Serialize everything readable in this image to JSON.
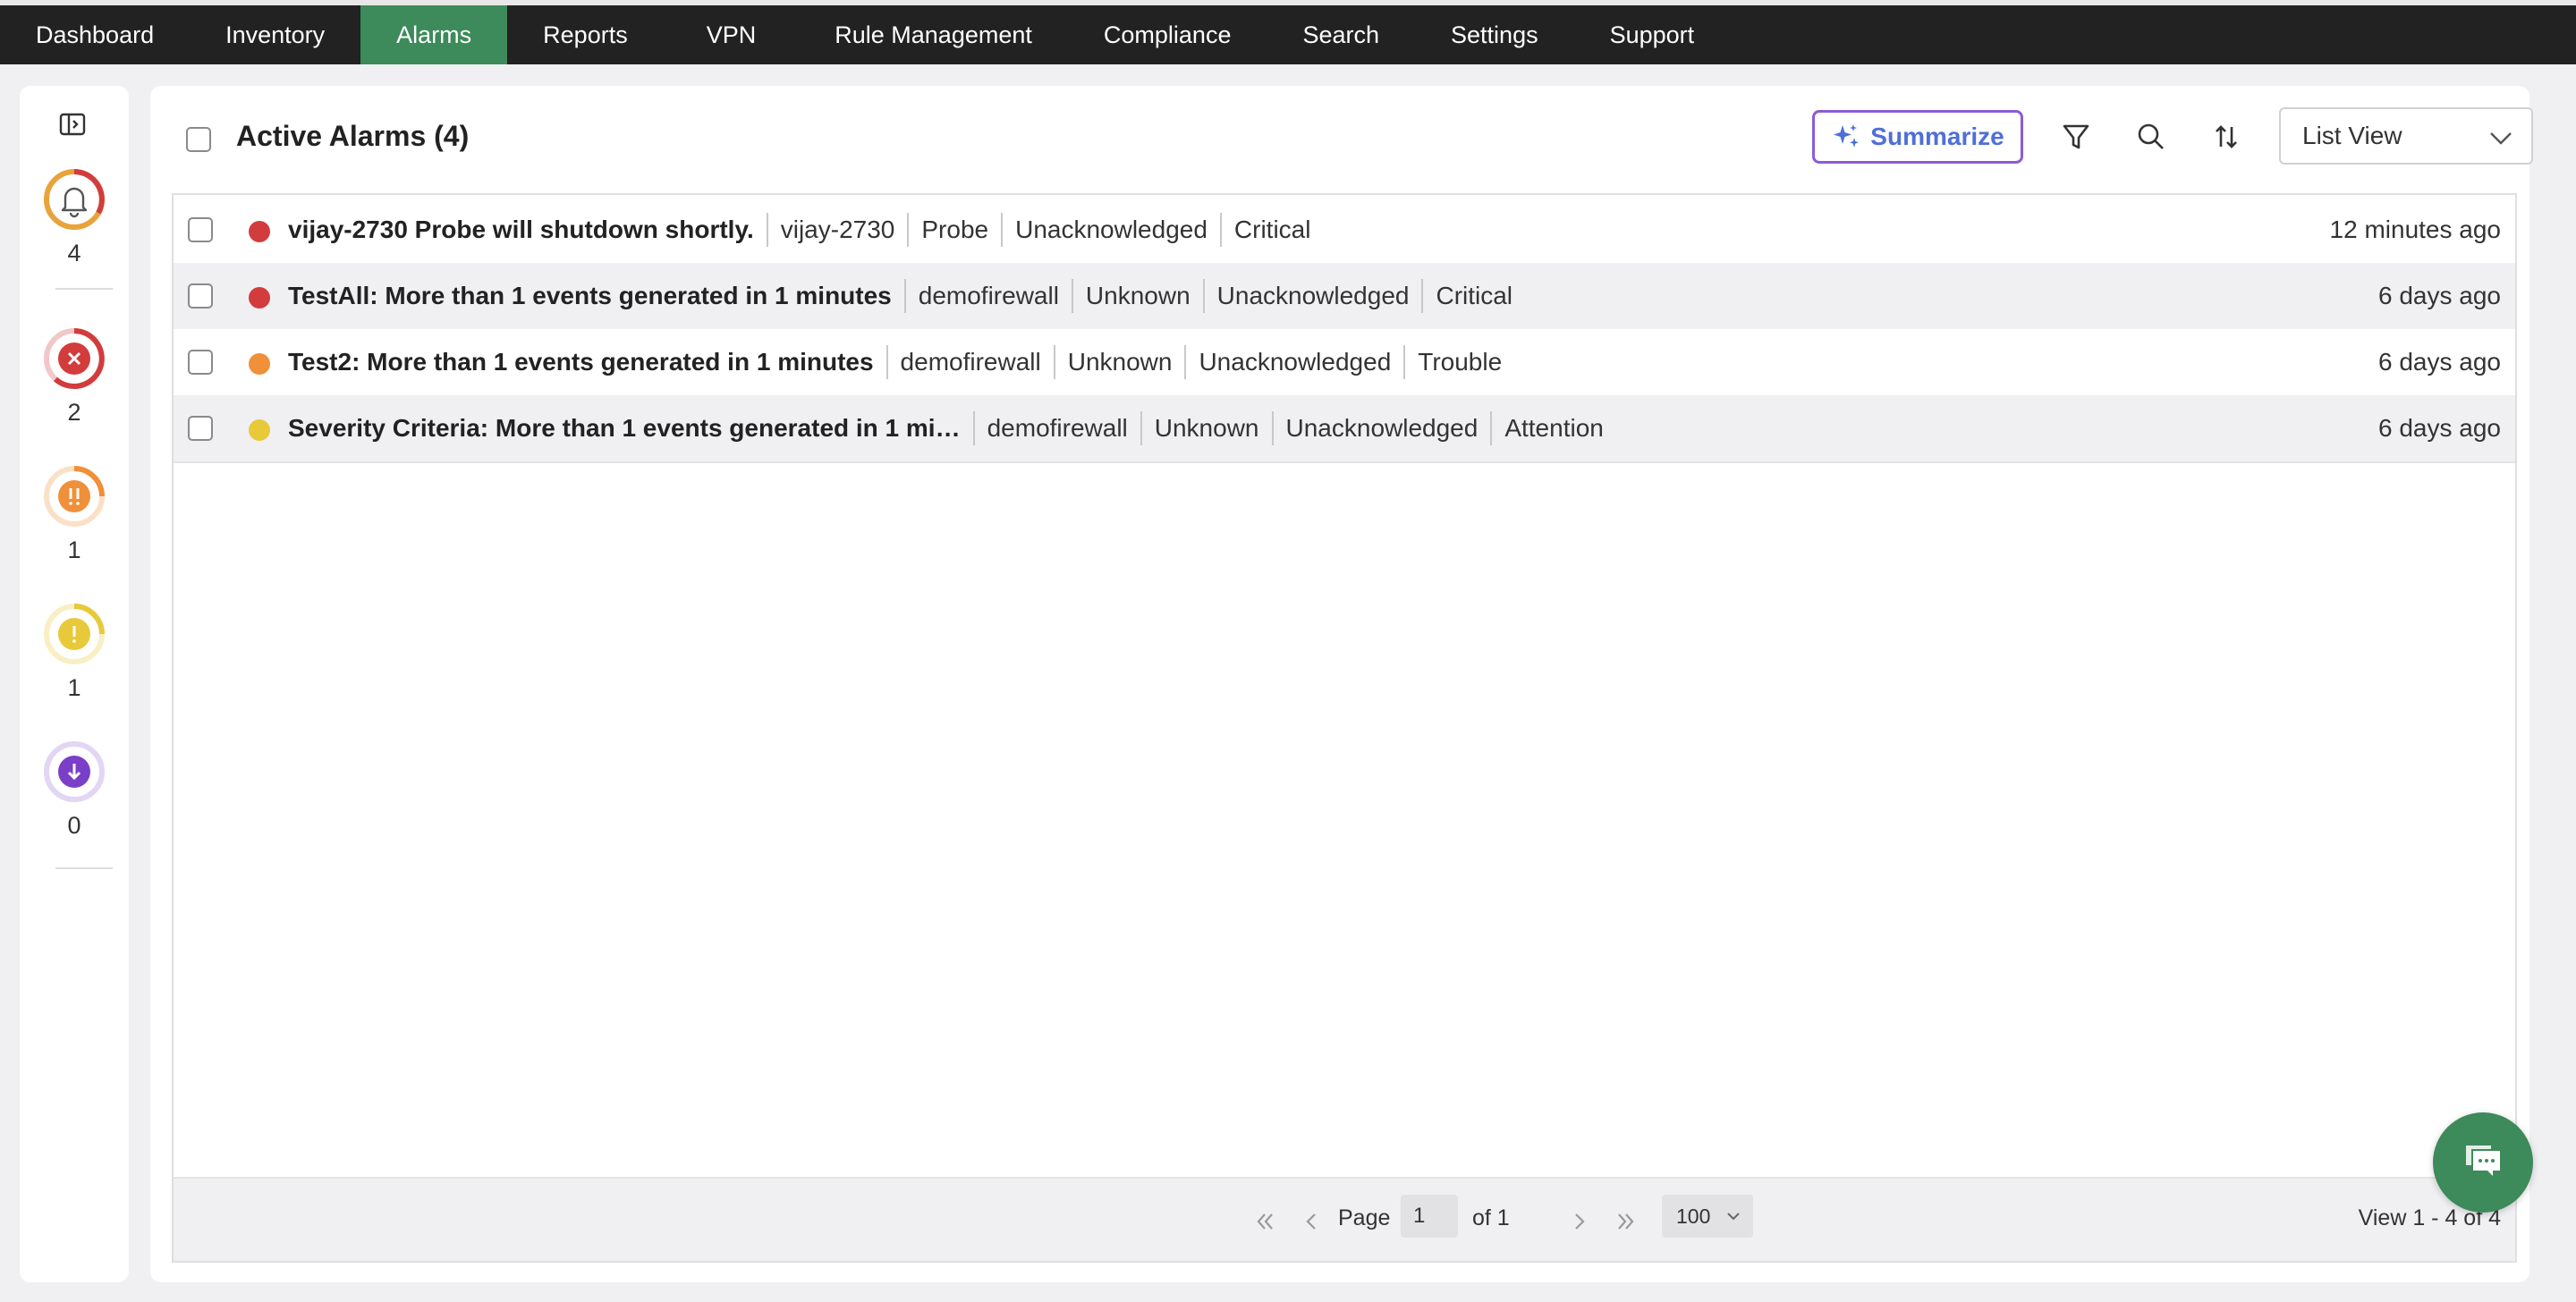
{
  "nav": {
    "items": [
      {
        "label": "Dashboard"
      },
      {
        "label": "Inventory"
      },
      {
        "label": "Alarms",
        "active": true
      },
      {
        "label": "Reports"
      },
      {
        "label": "VPN"
      },
      {
        "label": "Rule Management"
      },
      {
        "label": "Compliance"
      },
      {
        "label": "Search"
      },
      {
        "label": "Settings"
      },
      {
        "label": "Support"
      }
    ],
    "active_color": "#3d8a5a"
  },
  "sidebar": {
    "severities": [
      {
        "name": "all",
        "icon": "bell-icon",
        "count": "4",
        "color": "#e8a33a"
      },
      {
        "name": "critical",
        "icon": "x-circle-icon",
        "count": "2",
        "color": "#d23c3c"
      },
      {
        "name": "trouble",
        "icon": "double-exclamation-icon",
        "count": "1",
        "color": "#f0903a"
      },
      {
        "name": "attention",
        "icon": "exclamation-icon",
        "count": "1",
        "color": "#e8c93a"
      },
      {
        "name": "service-down",
        "icon": "arrow-down-icon",
        "count": "0",
        "color": "#7a3fc8"
      }
    ]
  },
  "main": {
    "title": "Active Alarms (4)",
    "summarize_label": "Summarize",
    "view_select": "List View"
  },
  "alarms": [
    {
      "title": "vijay-2730 Probe will shutdown shortly.",
      "cells": [
        "vijay-2730",
        "Probe",
        "Unacknowledged",
        "Critical"
      ],
      "time": "12 minutes ago",
      "severity_color": "#d23c3c"
    },
    {
      "title": "TestAll: More than 1 events generated in 1 minutes",
      "cells": [
        "demofirewall",
        "Unknown",
        "Unacknowledged",
        "Critical"
      ],
      "time": "6 days ago",
      "severity_color": "#d23c3c"
    },
    {
      "title": "Test2: More than 1 events generated in 1 minutes",
      "cells": [
        "demofirewall",
        "Unknown",
        "Unacknowledged",
        "Trouble"
      ],
      "time": "6 days ago",
      "severity_color": "#f0903a"
    },
    {
      "title": "Severity Criteria: More than 1 events generated in 1 mi…",
      "cells": [
        "demofirewall",
        "Unknown",
        "Unacknowledged",
        "Attention"
      ],
      "time": "6 days ago",
      "severity_color": "#e8c93a"
    }
  ],
  "pager": {
    "page_label": "Page",
    "page_value": "1",
    "of_label": "of 1",
    "page_size": "100",
    "view_range": "View 1 - 4 of 4"
  }
}
